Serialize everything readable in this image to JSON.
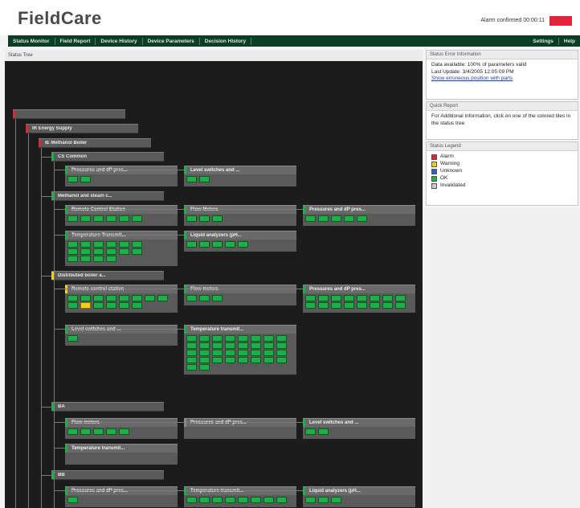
{
  "app": {
    "title": "FieldCare",
    "alarm_text": "Alarm confirmed 00:00:11",
    "alarm_color": "#e2243b"
  },
  "nav": {
    "items": [
      "Status Monitor",
      "Field Report",
      "Device History",
      "Device Parameters",
      "Decision History"
    ],
    "right_items": [
      "Settings",
      "Help"
    ]
  },
  "tree": {
    "header": "Status Tree",
    "nodes": [
      {
        "label": "",
        "status": "alarm"
      },
      {
        "label": "IR Energy Supply",
        "status": "alarm"
      },
      {
        "label": "IE Methanol Boiler",
        "status": "alarm"
      },
      {
        "label": "CS Common",
        "status": "ok"
      },
      {
        "label": "Methanol and steam c...",
        "status": "ok"
      },
      {
        "label": "Distributed boiler a...",
        "status": "warning"
      },
      {
        "label": "BA",
        "status": "ok"
      },
      {
        "label": "BB",
        "status": "ok"
      }
    ],
    "boxes": [
      {
        "label": "Pressures and dP pres...",
        "status": "ok",
        "cells": 2
      },
      {
        "label": "Level switches and ...",
        "status": "ok",
        "cells": 2
      },
      {
        "label": "Remote Control Station",
        "status": "ok",
        "cells": 6
      },
      {
        "label": "Flow Meters",
        "status": "ok",
        "cells": 3
      },
      {
        "label": "Pressures and dP pres...",
        "status": "ok",
        "cells": 5
      },
      {
        "label": "Temperature Transmit...",
        "status": "ok",
        "cells": 16
      },
      {
        "label": "Liquid analyzers (pH...",
        "status": "ok",
        "cells": 5
      },
      {
        "label": "Remote control station",
        "status": "warning",
        "cells": 14
      },
      {
        "label": "Flow meters",
        "status": "ok",
        "cells": 3
      },
      {
        "label": "Pressures and dP pres...",
        "status": "ok",
        "cells": 16
      },
      {
        "label": "Level switches and ...",
        "status": "ok",
        "cells": 1
      },
      {
        "label": "Temperature transmit...",
        "status": "ok",
        "cells": 34
      },
      {
        "label": "Flow meters",
        "status": "ok",
        "cells": 5
      },
      {
        "label": "Pressures and dP pres...",
        "status": "none",
        "cells": 0
      },
      {
        "label": "Level switches and ...",
        "status": "ok",
        "cells": 2
      },
      {
        "label": "Temperature transmit...",
        "status": "ok",
        "cells": 0
      },
      {
        "label": "Pressures and dP pres...",
        "status": "ok",
        "cells": 1
      },
      {
        "label": "Temperature transmit...",
        "status": "ok",
        "cells": 8
      },
      {
        "label": "Liquid analyzers (pH...",
        "status": "ok",
        "cells": 3
      }
    ]
  },
  "side": {
    "ssi": {
      "header": "Status Error Information",
      "line1": "Data available: 100% of parameters valid",
      "line2": "Last Update: 3/4/2005 12:05:09 PM",
      "link": "Show erroneous position with parts"
    },
    "quick": {
      "header": "Quick Report",
      "text": "For Additional information, click on one of the colored tiles in the status tree"
    },
    "legend": {
      "header": "Status Legend",
      "items": [
        {
          "label": "Alarm",
          "color": "#e2243b"
        },
        {
          "label": "Warning",
          "color": "#f2cf1f"
        },
        {
          "label": "Unknown",
          "color": "#2f5fc8"
        },
        {
          "label": "OK",
          "color": "#1db04a"
        },
        {
          "label": "Invalidated",
          "color": "#cccccc"
        }
      ]
    }
  },
  "colors": {
    "alarm": "#e2243b",
    "warning": "#f2cf1f",
    "ok": "#1db04a",
    "none": "#8a8a8a"
  }
}
